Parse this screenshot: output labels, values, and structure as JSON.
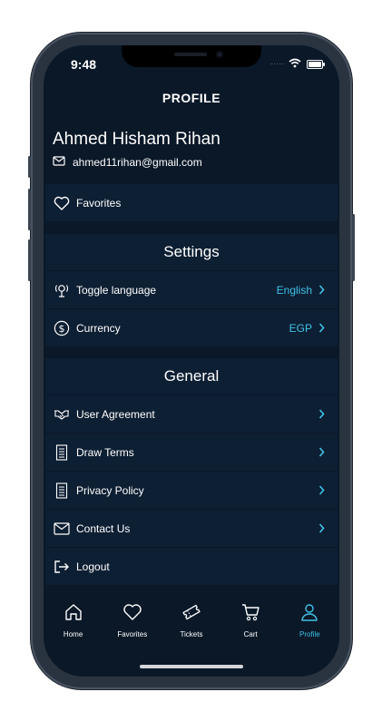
{
  "status_bar": {
    "time": "9:48",
    "dots": "....."
  },
  "header": {
    "title": "PROFILE"
  },
  "user": {
    "name": "Ahmed Hisham Rihan",
    "email": "ahmed11rihan@gmail.com"
  },
  "favorites": {
    "label": "Favorites"
  },
  "settings": {
    "title": "Settings",
    "items": [
      {
        "label": "Toggle language",
        "value": "English",
        "icon": "language-icon"
      },
      {
        "label": "Currency",
        "value": "EGP",
        "icon": "dollar-icon"
      }
    ]
  },
  "general": {
    "title": "General",
    "items": [
      {
        "label": "User Agreement",
        "icon": "handshake-icon"
      },
      {
        "label": "Draw Terms",
        "icon": "document-icon"
      },
      {
        "label": "Privacy Policy",
        "icon": "document-icon"
      },
      {
        "label": "Contact Us",
        "icon": "mail-icon"
      }
    ]
  },
  "logout": {
    "label": "Logout"
  },
  "tabbar": {
    "items": [
      {
        "label": "Home",
        "icon": "home-icon"
      },
      {
        "label": "Favorites",
        "icon": "heart-icon"
      },
      {
        "label": "Tickets",
        "icon": "ticket-icon"
      },
      {
        "label": "Cart",
        "icon": "cart-icon"
      },
      {
        "label": "Profile",
        "icon": "person-icon"
      }
    ],
    "active": "Profile"
  },
  "colors": {
    "background": "#0a1828",
    "row": "#0d1f33",
    "accent": "#3fc3e8"
  }
}
